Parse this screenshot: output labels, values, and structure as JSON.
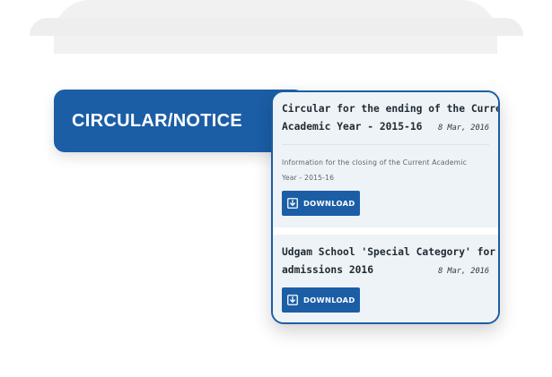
{
  "section": {
    "title": "CIRCULAR/NOTICE"
  },
  "notices": [
    {
      "title_line1": "Circular for the ending of the Current",
      "title_line2": "Academic Year - 2015-16",
      "date": "8 Mar, 2016",
      "description_line1": "Information for the closing of the Current Academic",
      "description_line2": "Year - 2015-16",
      "download_label": "DOWNLOAD",
      "download_icon": "download-arrow-icon"
    },
    {
      "title_line1": "Udgam School 'Special Category' for",
      "title_line2": "admissions 2016",
      "date": "8 Mar, 2016",
      "download_label": "DOWNLOAD",
      "download_icon": "download-arrow-icon"
    }
  ],
  "colors": {
    "accent": "#1b5ea6",
    "notice_bg": "#eef3f7",
    "text_dark": "#1f2a33",
    "text_muted": "#5e656b"
  }
}
